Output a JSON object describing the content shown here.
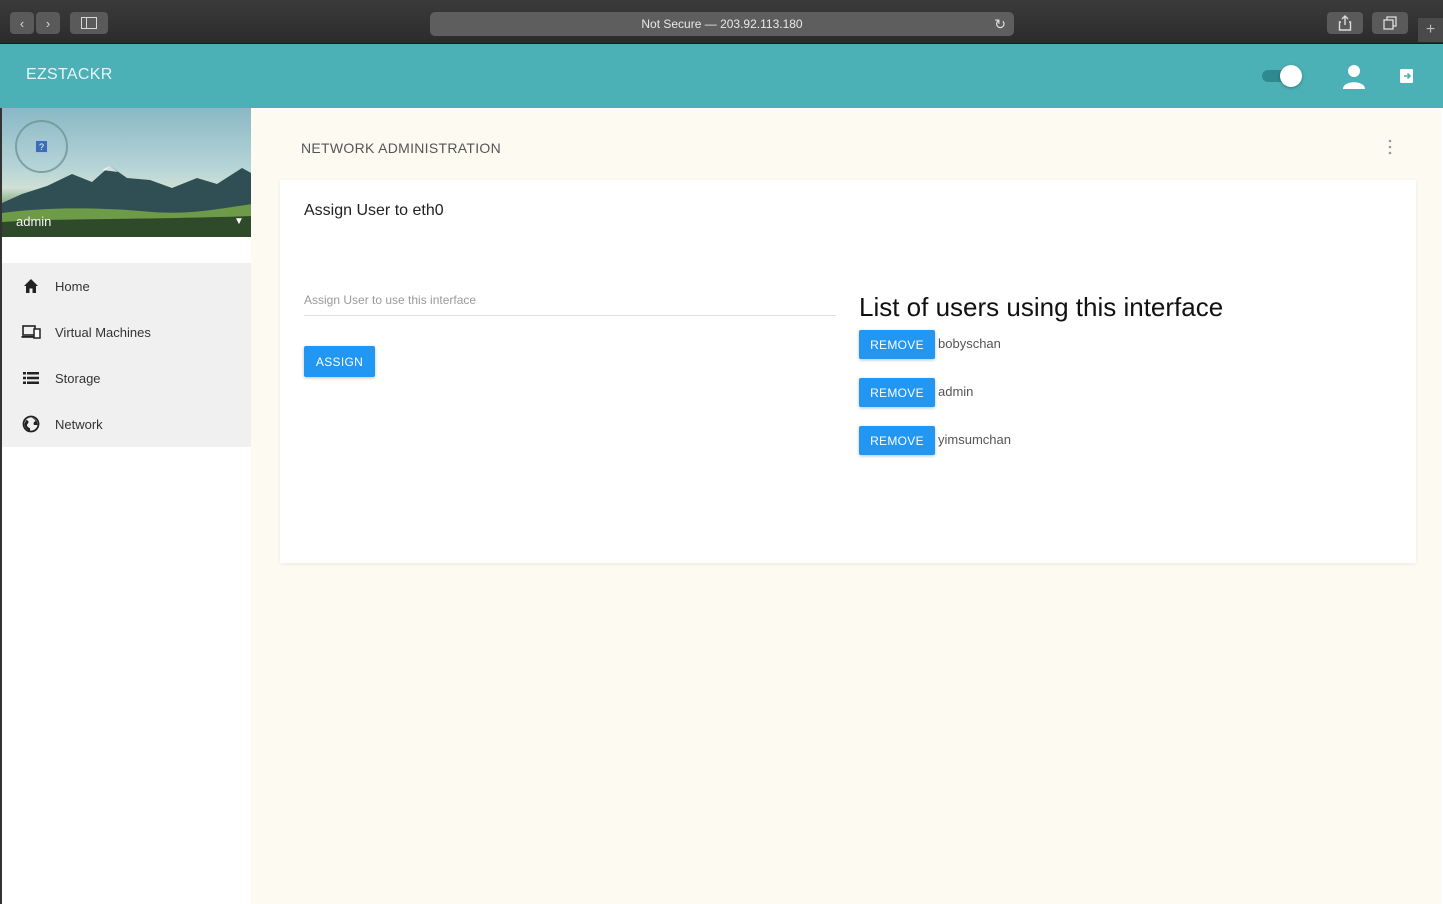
{
  "browser": {
    "url": "Not Secure — 203.92.113.180",
    "back_label": "‹",
    "forward_label": "›",
    "new_tab_label": "+"
  },
  "header": {
    "brand": "EZSTACKR",
    "accent_color": "#4cb0b7"
  },
  "sidebar": {
    "profile_name": "admin",
    "avatar_glyph": "?",
    "items": [
      {
        "label": "Home",
        "icon": "home-icon"
      },
      {
        "label": "Virtual Machines",
        "icon": "devices-icon"
      },
      {
        "label": "Storage",
        "icon": "list-icon"
      },
      {
        "label": "Network",
        "icon": "globe-icon"
      }
    ]
  },
  "main": {
    "page_title": "NETWORK ADMINISTRATION",
    "card": {
      "title": "Assign User to eth0",
      "input_placeholder": "Assign User to use this interface",
      "input_value": "",
      "assign_label": "ASSIGN",
      "users_heading": "List of users using this interface",
      "remove_label": "REMOVE",
      "users": [
        "bobyschan",
        "admin",
        "yimsumchan"
      ]
    }
  }
}
